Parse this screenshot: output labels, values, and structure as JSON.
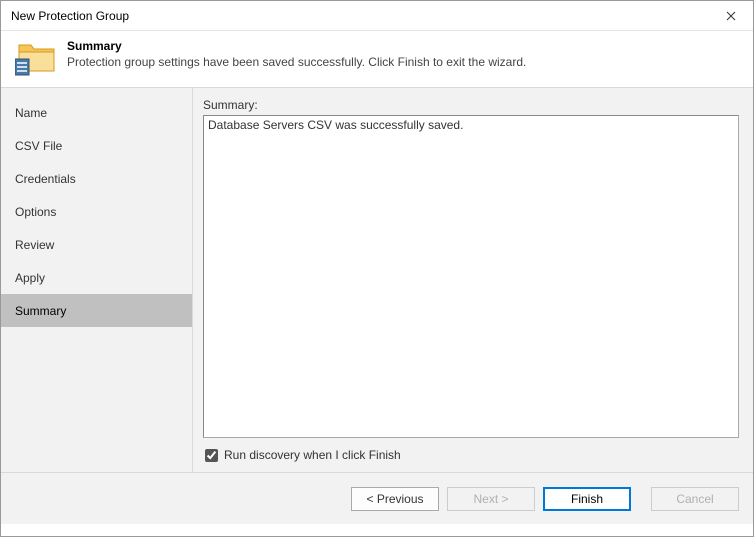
{
  "window": {
    "title": "New Protection Group"
  },
  "header": {
    "title": "Summary",
    "description": "Protection group settings have been saved successfully. Click Finish to exit the wizard."
  },
  "sidebar": {
    "items": [
      {
        "label": "Name"
      },
      {
        "label": "CSV File"
      },
      {
        "label": "Credentials"
      },
      {
        "label": "Options"
      },
      {
        "label": "Review"
      },
      {
        "label": "Apply"
      },
      {
        "label": "Summary"
      }
    ],
    "selected_index": 6
  },
  "main": {
    "summary_label": "Summary:",
    "summary_text": "Database Servers CSV was successfully saved.",
    "checkbox_label": "Run discovery when I click Finish",
    "checkbox_checked": true
  },
  "buttons": {
    "previous": "< Previous",
    "next": "Next >",
    "finish": "Finish",
    "cancel": "Cancel"
  }
}
